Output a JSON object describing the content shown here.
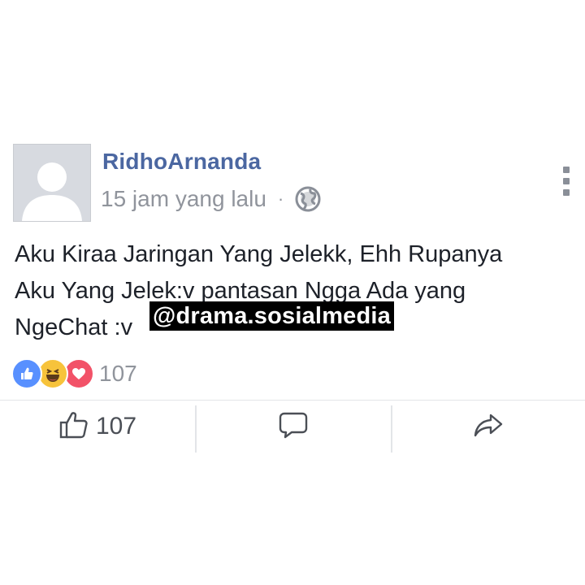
{
  "post": {
    "author": "RidhoArnanda",
    "timestamp": "15 jam yang lalu",
    "separator": "·",
    "privacy_icon": "globe-icon",
    "body_lines": [
      "Aku Kiraa Jaringan Yang Jelekk, Ehh Rupanya",
      "Aku Yang Jelek:v pantasan Ngga Ada yang",
      "NgeChat :v"
    ],
    "watermark": "@drama.sosialmedia"
  },
  "reactions": {
    "icons": [
      "like-reaction-icon",
      "haha-reaction-icon",
      "love-reaction-icon"
    ],
    "count": "107"
  },
  "actions": {
    "like_count": "107",
    "like_icon": "thumbs-up-icon",
    "comment_icon": "comment-icon",
    "share_icon": "share-icon"
  },
  "colors": {
    "author": "#4b67a1",
    "meta": "#90949c",
    "like_reaction": "#5890ff",
    "haha_reaction": "#f7c33b",
    "love_reaction": "#f25268"
  }
}
